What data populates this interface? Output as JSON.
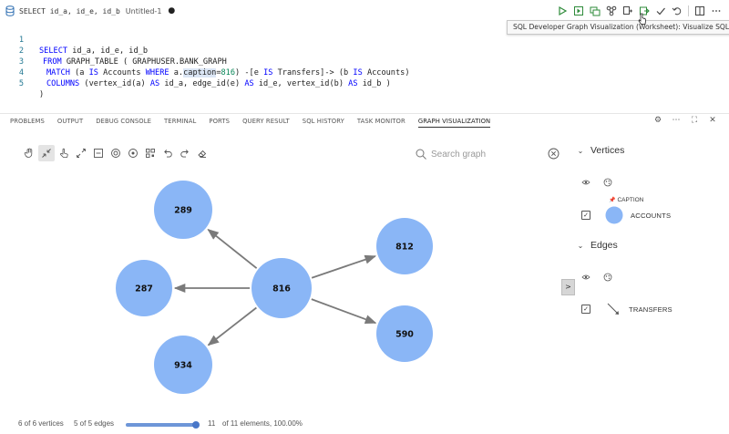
{
  "tab": {
    "title": "SELECT id_a, id_e, id_b",
    "subtitle": "Untitled-1",
    "dirty": "●"
  },
  "tooltip": "SQL Developer Graph Visualization (Worksheet): Visualize SQL Graph",
  "editor": {
    "lines": [
      {
        "num": "1"
      },
      {
        "num": "2"
      },
      {
        "num": "3"
      },
      {
        "num": "4"
      },
      {
        "num": "5"
      }
    ],
    "tokens": {
      "select": "SELECT",
      "select_cols": " id_a, id_e, id_b",
      "from": "FROM",
      "graph_table": " GRAPH_TABLE ( GRAPHUSER.BANK_GRAPH",
      "match": "MATCH",
      "l3_a": " (a ",
      "is1": "IS",
      "l3_b": " Accounts ",
      "where": "WHERE",
      "l3_c": " a.",
      "caption": "caption",
      "l3_d": "=",
      "num816": "816",
      "l3_e": ") -[e ",
      "is2": "IS",
      "l3_f": " Transfers]-> (b ",
      "is3": "IS",
      "l3_g": " Accounts)",
      "columns": "COLUMNS",
      "l4_a": " (vertex_id(a) ",
      "as1": "AS",
      "l4_b": " id_a, edge_id(e) ",
      "as2": "AS",
      "l4_c": " id_e, vertex_id(b) ",
      "as3": "AS",
      "l4_d": " id_b )",
      "close": ")"
    }
  },
  "panel": {
    "tabs": [
      "PROBLEMS",
      "OUTPUT",
      "DEBUG CONSOLE",
      "TERMINAL",
      "PORTS",
      "QUERY RESULT",
      "SQL HISTORY",
      "TASK MONITOR",
      "GRAPH VISUALIZATION"
    ],
    "active_tab": "GRAPH VISUALIZATION"
  },
  "search": {
    "placeholder": "Search graph"
  },
  "graph": {
    "node_color": "#8ab6f6",
    "edge_color": "#7a7a7a",
    "nodes": [
      {
        "id": "816",
        "label": "816"
      },
      {
        "id": "289",
        "label": "289"
      },
      {
        "id": "287",
        "label": "287"
      },
      {
        "id": "934",
        "label": "934"
      },
      {
        "id": "812",
        "label": "812"
      },
      {
        "id": "590",
        "label": "590"
      }
    ],
    "edges": [
      {
        "from": "816",
        "to": "289"
      },
      {
        "from": "816",
        "to": "287"
      },
      {
        "from": "816",
        "to": "934"
      },
      {
        "from": "816",
        "to": "812"
      },
      {
        "from": "816",
        "to": "590"
      }
    ]
  },
  "legend": {
    "vertices_title": "Vertices",
    "edges_title": "Edges",
    "caption_tag": "CAPTION",
    "vertex_label": "ACCOUNTS",
    "edge_label": "TRANSFERS",
    "collapse_symbol": ">"
  },
  "status": {
    "vertices": "6 of 6 vertices",
    "edges": "5 of 5 edges",
    "slider_value": "11",
    "elements": "of 11 elements, 100.00%",
    "slider_fraction": 1.0
  }
}
